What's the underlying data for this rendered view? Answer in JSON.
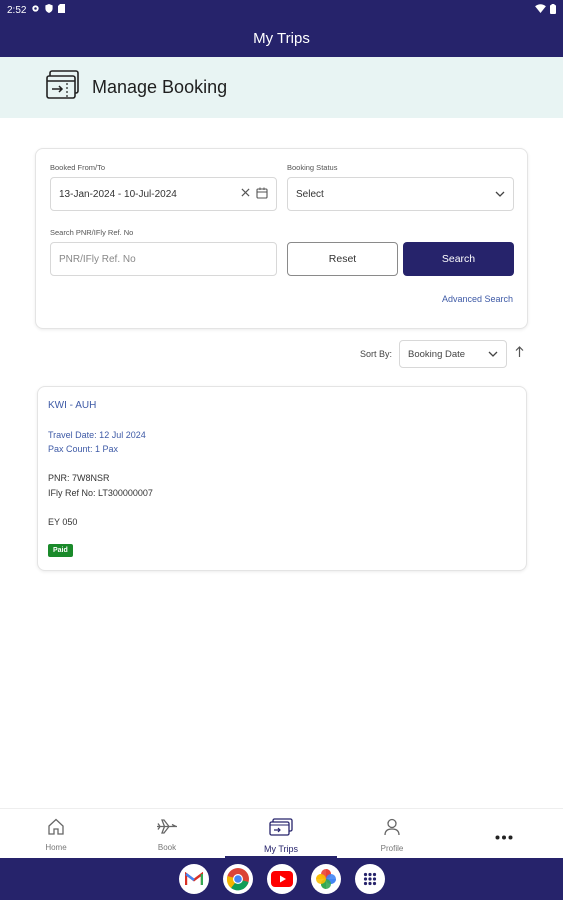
{
  "status_bar": {
    "time": "2:52"
  },
  "app_bar": {
    "title": "My Trips"
  },
  "banner": {
    "title": "Manage Booking"
  },
  "filters": {
    "booked_label": "Booked From/To",
    "booked_value": "13-Jan-2024 - 10-Jul-2024",
    "status_label": "Booking Status",
    "status_value": "Select",
    "search_label": "Search PNR/IFly Ref. No",
    "search_placeholder": "PNR/IFly Ref. No",
    "reset_label": "Reset",
    "search_button_label": "Search",
    "advanced_search_label": "Advanced Search"
  },
  "sort": {
    "label": "Sort By:",
    "value": "Booking Date"
  },
  "trip": {
    "route": "KWI - AUH",
    "travel_date": "Travel Date: 12 Jul 2024",
    "pax_count": "Pax Count: 1 Pax",
    "pnr": "PNR: 7W8NSR",
    "ifly_ref": "IFly Ref No: LT300000007",
    "flight": "EY 050",
    "status": "Paid",
    "status_color": "#1a8a2a"
  },
  "bottom_nav": {
    "items": [
      {
        "label": "Home",
        "icon": "home-icon"
      },
      {
        "label": "Book",
        "icon": "plane-icon"
      },
      {
        "label": "My Trips",
        "icon": "ticket-icon",
        "active": true
      },
      {
        "label": "Profile",
        "icon": "profile-icon"
      },
      {
        "label": "",
        "icon": "more-icon"
      }
    ]
  },
  "dock_apps": [
    "gmail-icon",
    "chrome-icon",
    "youtube-icon",
    "photos-icon",
    "app-drawer-icon"
  ],
  "colors": {
    "primary": "#26236b",
    "banner_bg": "#e8f4f3",
    "link": "#3e5aa6",
    "paid": "#1a8a2a"
  }
}
